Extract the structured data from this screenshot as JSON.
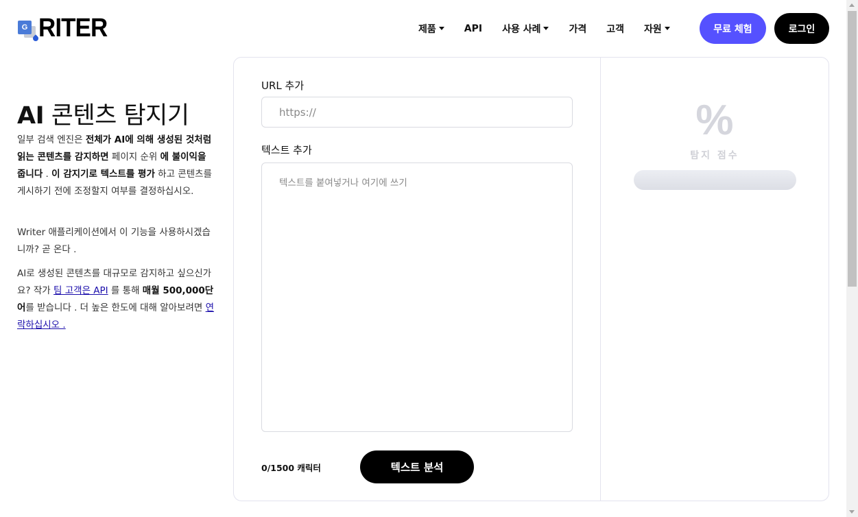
{
  "logo": {
    "text": "RITER"
  },
  "nav": {
    "items": [
      {
        "label": "제품",
        "dropdown": true
      },
      {
        "label": "API",
        "dropdown": false
      },
      {
        "label": "사용 사례",
        "dropdown": true
      },
      {
        "label": "가격",
        "dropdown": false
      },
      {
        "label": "고객",
        "dropdown": false
      },
      {
        "label": "자원",
        "dropdown": true
      }
    ],
    "trial_label": "무료 체험",
    "login_label": "로그인"
  },
  "intro": {
    "title_ai": "AI",
    "title_rest": " 콘텐츠 탐지기",
    "p1": {
      "t1": "일부 검색 엔진은 ",
      "b1": "전체가 AI에 의해 생성된 것처럼 읽는 콘텐츠를 감지하면",
      "t2": " 페이지 순위 ",
      "b2": "에 불이익을 줍니다",
      "t3": " . ",
      "b3": "이 감지기로 텍스트를 평가",
      "t4": " 하고 콘텐츠를 게시하기 전에 조정할지 여부를 결정하십시오."
    },
    "p2": "Writer 애플리케이션에서 이 기능을 사용하시겠습니까? 곧 온다 .",
    "p3": {
      "t1": "AI로 생성된 콘텐츠를 대규모로 감지하고 싶으신가요? 작가 ",
      "link1": "팀 고객은 API",
      "t2": " 를 통해 ",
      "b1": "매월 500,000단어",
      "t3": "를 받습니다 . 더 높은 한도에 대해 알아보려면 ",
      "link2": "연락하십시오 ."
    }
  },
  "form": {
    "url_label": "URL 추가",
    "url_placeholder": "https://",
    "text_label": "텍스트 추가",
    "text_placeholder": "텍스트를 붙여넣거나 여기에 쓰기",
    "char_count": "0/1500 캐릭터",
    "analyze_label": "텍스트 분석"
  },
  "score": {
    "symbol": "%",
    "label": "탐지 점수"
  }
}
